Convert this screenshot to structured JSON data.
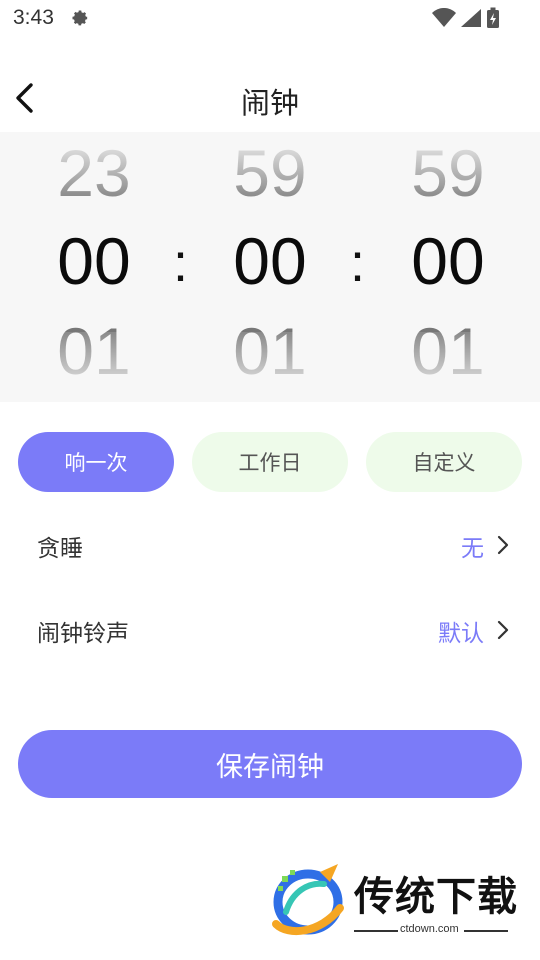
{
  "status_bar": {
    "time": "3:43",
    "icons": [
      "gear-icon",
      "wifi-icon",
      "signal-icon",
      "battery-charging-icon"
    ]
  },
  "header": {
    "title": "闹钟",
    "back_icon": "chevron-left-icon"
  },
  "time_picker": {
    "separator": ":",
    "hours": {
      "prev": "23",
      "current": "00",
      "next": "01"
    },
    "minutes": {
      "prev": "59",
      "current": "00",
      "next": "01"
    },
    "seconds": {
      "prev": "59",
      "current": "00",
      "next": "01"
    }
  },
  "repeat_options": [
    {
      "label": "响一次",
      "selected": true
    },
    {
      "label": "工作日",
      "selected": false
    },
    {
      "label": "自定义",
      "selected": false
    }
  ],
  "settings": {
    "snooze": {
      "label": "贪睡",
      "value": "无"
    },
    "ringtone": {
      "label": "闹钟铃声",
      "value": "默认"
    }
  },
  "save_button": {
    "label": "保存闹钟"
  },
  "watermark": {
    "name": "传统下载",
    "url": "ctdown.com"
  },
  "colors": {
    "accent": "#7b7bf8",
    "inactive_chip": "#eefbea",
    "picker_bg": "#f7f7f7"
  }
}
